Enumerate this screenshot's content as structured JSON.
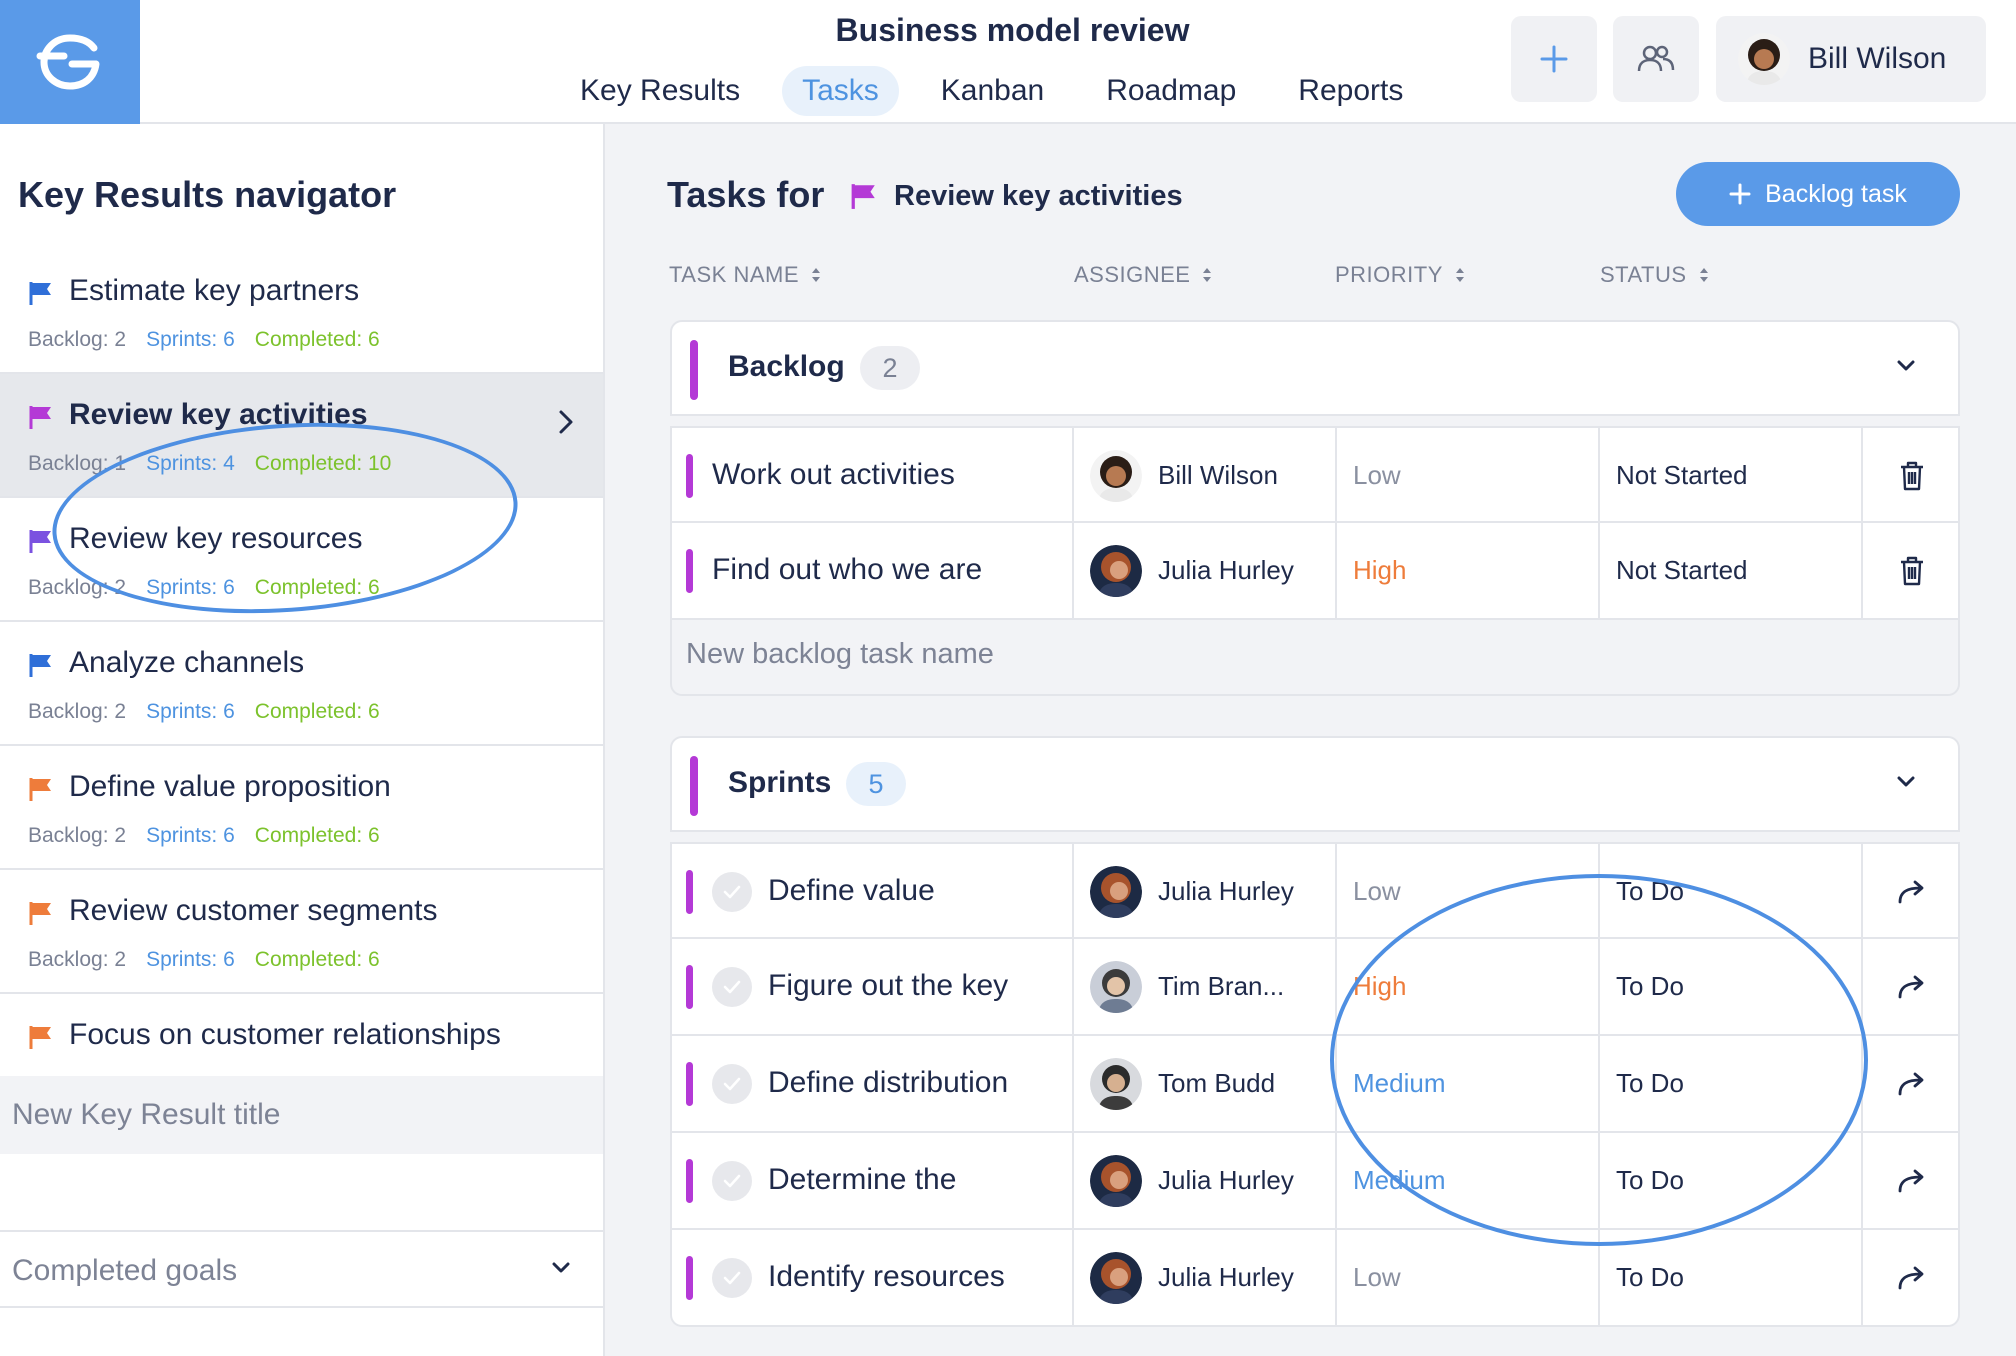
{
  "header": {
    "board_title": "Business model review",
    "tabs": [
      {
        "label": "Key Results",
        "active": false
      },
      {
        "label": "Tasks",
        "active": true
      },
      {
        "label": "Kanban",
        "active": false
      },
      {
        "label": "Roadmap",
        "active": false
      },
      {
        "label": "Reports",
        "active": false
      }
    ],
    "add_icon": "plus-icon",
    "team_icon": "users-icon",
    "user_name": "Bill Wilson",
    "accent_color": "#5a9ae8"
  },
  "sidebar": {
    "title": "Key Results navigator",
    "items": [
      {
        "title": "Estimate key partners",
        "flag_color": "#2f6fd8",
        "backlog": "Backlog: 2",
        "sprints": "Sprints: 6",
        "completed": "Completed: 6",
        "active": false
      },
      {
        "title": "Review key activities",
        "flag_color": "#b439d6",
        "backlog": "Backlog: 1",
        "sprints": "Sprints: 4",
        "completed": "Completed: 10",
        "active": true
      },
      {
        "title": "Review key resources",
        "flag_color": "#7b52e0",
        "backlog": "Backlog: 2",
        "sprints": "Sprints: 6",
        "completed": "Completed: 6",
        "active": false
      },
      {
        "title": "Analyze channels",
        "flag_color": "#2f6fd8",
        "backlog": "Backlog: 2",
        "sprints": "Sprints: 6",
        "completed": "Completed: 6",
        "active": false
      },
      {
        "title": "Define value proposition",
        "flag_color": "#ee7c3b",
        "backlog": "Backlog: 2",
        "sprints": "Sprints: 6",
        "completed": "Completed: 6",
        "active": false
      },
      {
        "title": "Review customer segments",
        "flag_color": "#ee7c3b",
        "backlog": "Backlog: 2",
        "sprints": "Sprints: 6",
        "completed": "Completed: 6",
        "active": false
      },
      {
        "title": "Focus on customer relationships",
        "flag_color": "#ee7c3b",
        "active": false
      }
    ],
    "new_kr_placeholder": "New Key Result title",
    "completed_goals": "Completed goals"
  },
  "main": {
    "title": "Tasks for",
    "kr_name": "Review key activities",
    "kr_flag_color": "#b439d6",
    "backlog_button": "Backlog task",
    "columns": [
      "TASK NAME",
      "ASSIGNEE",
      "PRIORITY",
      "STATUS"
    ],
    "backlog": {
      "title": "Backlog",
      "count": "2",
      "tasks": [
        {
          "name": "Work out activities",
          "assignee": "Bill Wilson",
          "priority": "Low",
          "status": "Not Started",
          "action_icon": "trash-icon"
        },
        {
          "name": "Find out who we are",
          "assignee": "Julia Hurley",
          "priority": "High",
          "status": "Not Started",
          "action_icon": "trash-icon"
        }
      ],
      "new_task_placeholder": "New backlog task name"
    },
    "sprints": {
      "title": "Sprints",
      "count": "5",
      "tasks": [
        {
          "name": "Define value",
          "assignee": "Julia Hurley",
          "priority": "Low",
          "status": "To Do",
          "action_icon": "forward-arrow-icon"
        },
        {
          "name": "Figure out the key",
          "assignee": "Tim Bran...",
          "priority": "High",
          "status": "To Do",
          "action_icon": "forward-arrow-icon"
        },
        {
          "name": "Define distribution",
          "assignee": "Tom Budd",
          "priority": "Medium",
          "status": "To Do",
          "action_icon": "forward-arrow-icon"
        },
        {
          "name": "Determine the",
          "assignee": "Julia Hurley",
          "priority": "Medium",
          "status": "To Do",
          "action_icon": "forward-arrow-icon"
        },
        {
          "name": "Identify resources",
          "assignee": "Julia Hurley",
          "priority": "Low",
          "status": "To Do",
          "action_icon": "forward-arrow-icon"
        }
      ]
    }
  }
}
